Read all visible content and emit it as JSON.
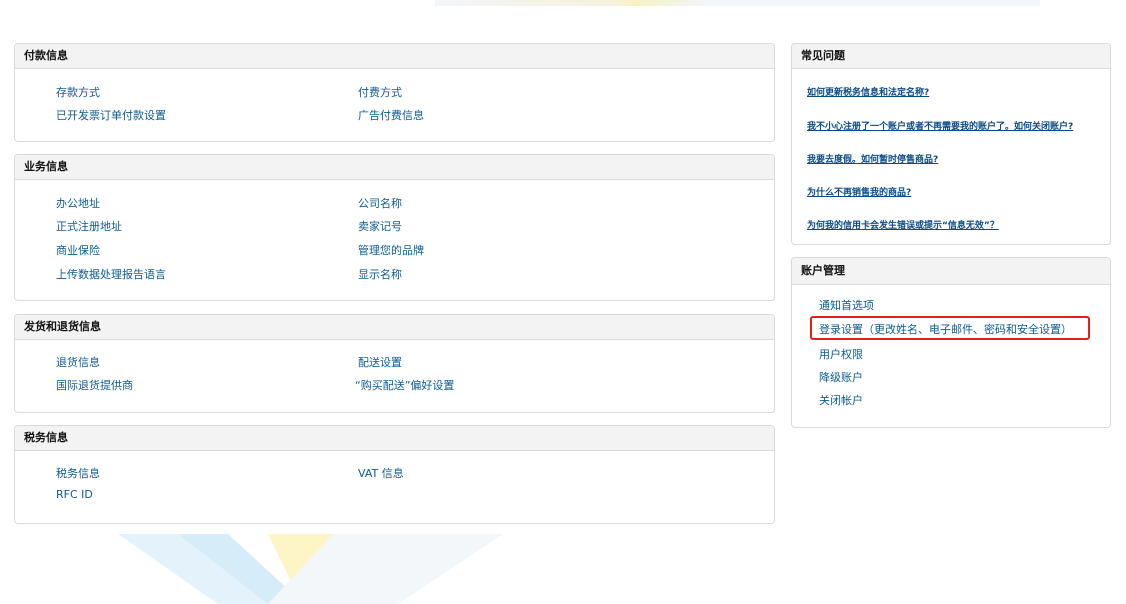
{
  "payment": {
    "title": "付款信息",
    "links": [
      "存款方式",
      "付费方式",
      "已开发票订单付款设置",
      "广告付费信息"
    ]
  },
  "business": {
    "title": "业务信息",
    "links": [
      "办公地址",
      "公司名称",
      "正式注册地址",
      "卖家记号",
      "商业保险",
      "管理您的品牌",
      "上传数据处理报告语言",
      "显示名称"
    ]
  },
  "shipping": {
    "title": "发货和退货信息",
    "links": [
      "退货信息",
      "配送设置",
      "国际退货提供商",
      "“购买配送”偏好设置"
    ]
  },
  "tax": {
    "title": "税务信息",
    "links": [
      "税务信息",
      "VAT 信息",
      "RFC ID"
    ]
  },
  "faq": {
    "title": "常见问题",
    "links": [
      "如何更新税务信息和法定名称?",
      "我不小心注册了一个账户或者不再需要我的账户了。如何关闭账户?",
      "我要去度假。如何暂时停售商品?",
      "为什么不再销售我的商品?",
      "为何我的信用卡会发生错误或提示“信息无效”？"
    ]
  },
  "account": {
    "title": "账户管理",
    "links": [
      "通知首选项",
      "登录设置（更改姓名、电子邮件、密码和安全设置）",
      "用户权限",
      "降级账户",
      "关闭帐户"
    ]
  },
  "colors": {
    "link": "#0b5b8f",
    "faq_link": "#0a4a86",
    "highlight": "#e0201a",
    "header_bg": "#f3f3f3"
  }
}
